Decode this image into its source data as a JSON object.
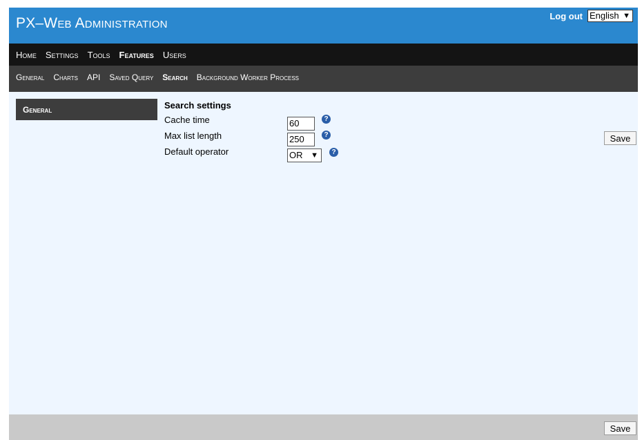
{
  "header": {
    "title": "PX–Web Administration",
    "logout_label": "Log out",
    "language": "English"
  },
  "main_nav": [
    {
      "label": "Home",
      "active": false
    },
    {
      "label": "Settings",
      "active": false
    },
    {
      "label": "Tools",
      "active": false
    },
    {
      "label": "Features",
      "active": true
    },
    {
      "label": "Users",
      "active": false
    }
  ],
  "sub_nav": [
    {
      "label": "General",
      "active": false
    },
    {
      "label": "Charts",
      "active": false
    },
    {
      "label": "API",
      "active": false
    },
    {
      "label": "Saved Query",
      "active": false
    },
    {
      "label": "Search",
      "active": true
    },
    {
      "label": "Background Worker Process",
      "active": false
    }
  ],
  "save_label": "Save",
  "sidebar": {
    "item": "General"
  },
  "search_settings": {
    "title": "Search settings",
    "cache_time": {
      "label": "Cache time",
      "value": "60"
    },
    "max_list_length": {
      "label": "Max list length",
      "value": "250"
    },
    "default_operator": {
      "label": "Default operator",
      "value": "OR"
    }
  },
  "icons": {
    "help": "question-mark-icon",
    "dropdown": "chevron-down-icon"
  },
  "colors": {
    "header": "#2b88cf",
    "main_nav": "#141414",
    "sub_nav": "#3d3d3d",
    "content_bg": "#eef6ff",
    "footer": "#c9c9c9"
  }
}
